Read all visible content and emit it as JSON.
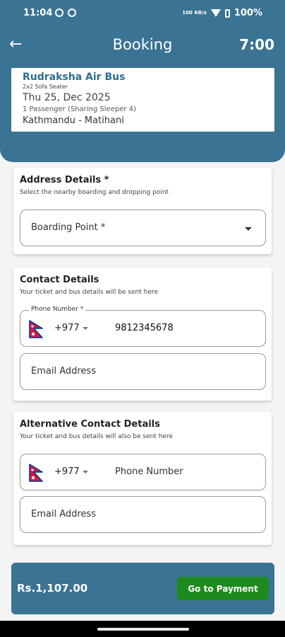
{
  "status_bar": {
    "time": "11:04",
    "network": "100 KB/s",
    "battery": "100%"
  },
  "header": {
    "title": "Booking",
    "timer": "7:00"
  },
  "trip": {
    "bus_name": "Rudraksha Air Bus",
    "seat_type": "2x2 Sofa Seater",
    "date": "Thu 25, Dec 2025",
    "passengers": "1 Passenger (Sharing Sleeper 4)",
    "route": "Kathmandu - Matihani"
  },
  "address": {
    "title": "Address Details *",
    "subtitle": "Select the nearby boarding and dropping point",
    "boarding_placeholder": "Boarding Point *"
  },
  "contact": {
    "title": "Contact Details",
    "subtitle": "Your ticket and bus details will be sent here",
    "phone_label": "Phone Number *",
    "country_code": "+977",
    "phone_value": "9812345678",
    "email_placeholder": "Email Address"
  },
  "alt_contact": {
    "title": "Alternative Contact Details",
    "subtitle": "Your ticket and bus details will also be sent here",
    "country_code": "+977",
    "phone_placeholder": "Phone Number",
    "email_placeholder": "Email Address"
  },
  "footer": {
    "price": "Rs.1,107.00",
    "pay_label": "Go to Payment"
  },
  "colors": {
    "primary": "#3a7393",
    "accent_green": "#1c8a1c",
    "bus_name": "#2e6e90",
    "flag_red": "#dc143c",
    "flag_blue": "#003893"
  }
}
